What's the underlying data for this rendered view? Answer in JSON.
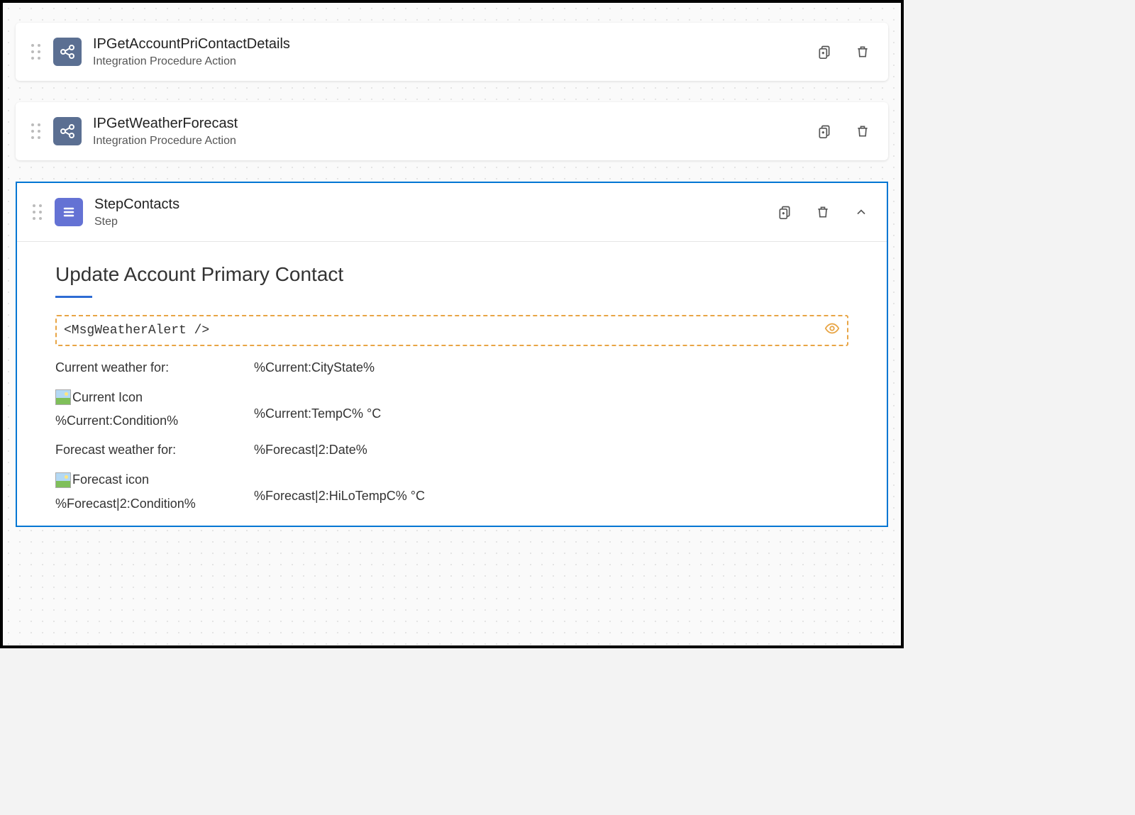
{
  "elements": [
    {
      "title": "IPGetAccountPriContactDetails",
      "subtitle": "Integration Procedure Action"
    },
    {
      "title": "IPGetWeatherForecast",
      "subtitle": "Integration Procedure Action"
    },
    {
      "title": "StepContacts",
      "subtitle": "Step"
    }
  ],
  "step_body": {
    "section_title": "Update Account Primary Contact",
    "placeholder_tag": "<MsgWeatherAlert />",
    "rows": {
      "current_label": "Current weather for:",
      "current_value": "%Current:CityState%",
      "current_icon_alt": "Current Icon",
      "current_condition": "%Current:Condition%",
      "current_temp": "%Current:TempC% °C",
      "forecast_label": "Forecast weather for:",
      "forecast_value": "%Forecast|2:Date%",
      "forecast_icon_alt": "Forecast icon",
      "forecast_condition": "%Forecast|2:Condition%",
      "forecast_temp": "%Forecast|2:HiLoTempC% °C"
    }
  }
}
